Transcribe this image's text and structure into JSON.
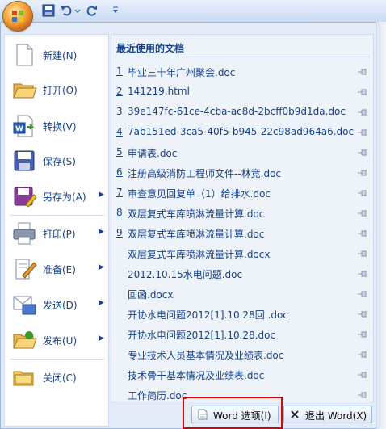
{
  "topbar": {
    "qa_icons": [
      "save-icon",
      "undo-icon",
      "redo-icon",
      "customize-icon"
    ]
  },
  "commands": [
    {
      "label": "新建(N)",
      "icon": "new-document-icon",
      "has_submenu": false
    },
    {
      "label": "打开(O)",
      "icon": "open-folder-icon",
      "has_submenu": false
    },
    {
      "label": "转换(V)",
      "icon": "convert-icon",
      "has_submenu": false
    },
    {
      "label": "保存(S)",
      "icon": "save-icon",
      "has_submenu": false
    },
    {
      "label": "另存为(A)",
      "icon": "save-as-icon",
      "has_submenu": true
    },
    {
      "label": "打印(P)",
      "icon": "print-icon",
      "has_submenu": true
    },
    {
      "label": "准备(E)",
      "icon": "prepare-icon",
      "has_submenu": true
    },
    {
      "label": "发送(D)",
      "icon": "send-icon",
      "has_submenu": true
    },
    {
      "label": "发布(U)",
      "icon": "publish-icon",
      "has_submenu": true
    },
    {
      "label": "关闭(C)",
      "icon": "close-folder-icon",
      "has_submenu": false
    }
  ],
  "recent": {
    "title": "最近使用的文档",
    "documents": [
      {
        "num": "1",
        "name": "毕业三十年广州聚会.doc"
      },
      {
        "num": "2",
        "name": "141219.html"
      },
      {
        "num": "3",
        "name": "39e147fc-61ce-4cba-ac8d-2bcff0b9d1da.doc"
      },
      {
        "num": "4",
        "name": "7ab151ed-3ca5-40f5-b945-22c98ad964a6.doc"
      },
      {
        "num": "5",
        "name": "申请表.doc"
      },
      {
        "num": "6",
        "name": "注册高级消防工程师文件--林竞.doc"
      },
      {
        "num": "7",
        "name": "审查意见回复单（1）给排水.doc"
      },
      {
        "num": "8",
        "name": "双层复式车库喷淋流量计算.doc"
      },
      {
        "num": "9",
        "name": "双层复式车库喷淋流量计算.doc"
      },
      {
        "num": "",
        "name": "双层复式车库喷淋流量计算.docx"
      },
      {
        "num": "",
        "name": "2012.10.15水电问题.doc"
      },
      {
        "num": "",
        "name": "回函.docx"
      },
      {
        "num": "",
        "name": "开协水电问题2012[1].10.28回 .doc"
      },
      {
        "num": "",
        "name": "开协水电问题2012[1].10.28.doc"
      },
      {
        "num": "",
        "name": "专业技术人员基本情况及业绩表.doc"
      },
      {
        "num": "",
        "name": "技术骨干基本情况及业绩表.doc"
      },
      {
        "num": "",
        "name": "工作简历.doc"
      }
    ]
  },
  "bottom": {
    "word_options_label": "Word 选项(I)",
    "exit_word_label": "退出 Word(X)"
  },
  "colors": {
    "text": "#15428b",
    "highlight": "#e00000",
    "menu_bg": "#e3ecf8"
  }
}
